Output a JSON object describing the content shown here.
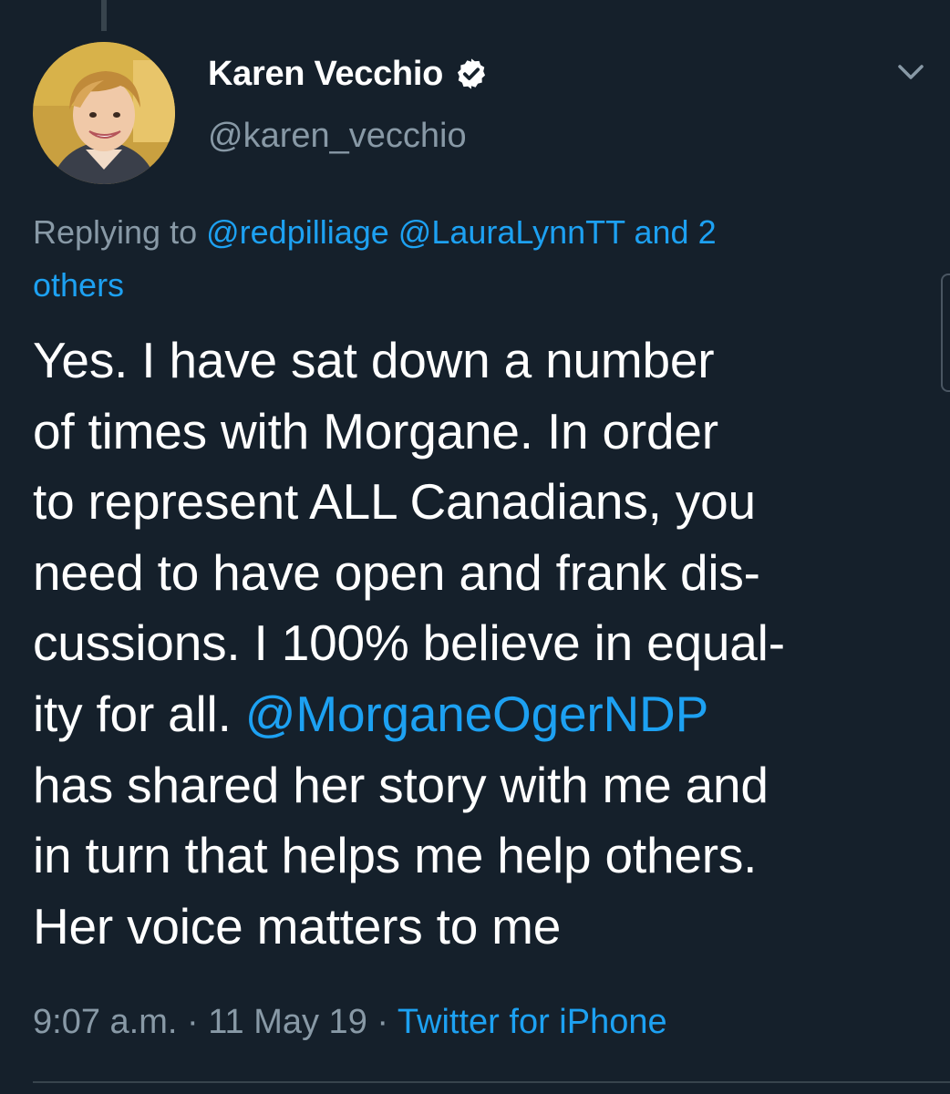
{
  "tweet": {
    "author": {
      "display_name": "Karen Vecchio",
      "handle": "@karen_vecchio",
      "verified_icon": "verified-badge-icon",
      "avatar": "profile-photo"
    },
    "reply_context": {
      "prefix": "Replying to",
      "mention_1": "@redpilliage",
      "mention_2": "@LauraLynnTT",
      "suffix_line1": "and 2",
      "suffix_line2": "others"
    },
    "body_lines": {
      "l1": "Yes. I have sat down a number",
      "l2": "of times with Morgane. In order",
      "l3": "to represent ALL Canadians, you",
      "l4": "need to have open and frank dis-",
      "l5": "cussions. I 100% believe in equal-",
      "l6_text": "ity for all. ",
      "l6_mention": "@MorganeOgerNDP",
      "l7": "has shared her story with me and",
      "l8": "in turn that helps me help others.",
      "l9": "Her voice matters to me"
    },
    "meta": {
      "time": "9:07 a.m.",
      "separator": " · ",
      "date": "11 May 19",
      "source": "Twitter for iPhone"
    }
  },
  "icons": {
    "more": "chevron-down-icon",
    "verified": "verified-badge-icon"
  },
  "colors": {
    "background": "#15202b",
    "text_primary": "#ffffff",
    "text_secondary": "#8899a6",
    "link": "#1da1f2",
    "divider": "#38444d"
  }
}
